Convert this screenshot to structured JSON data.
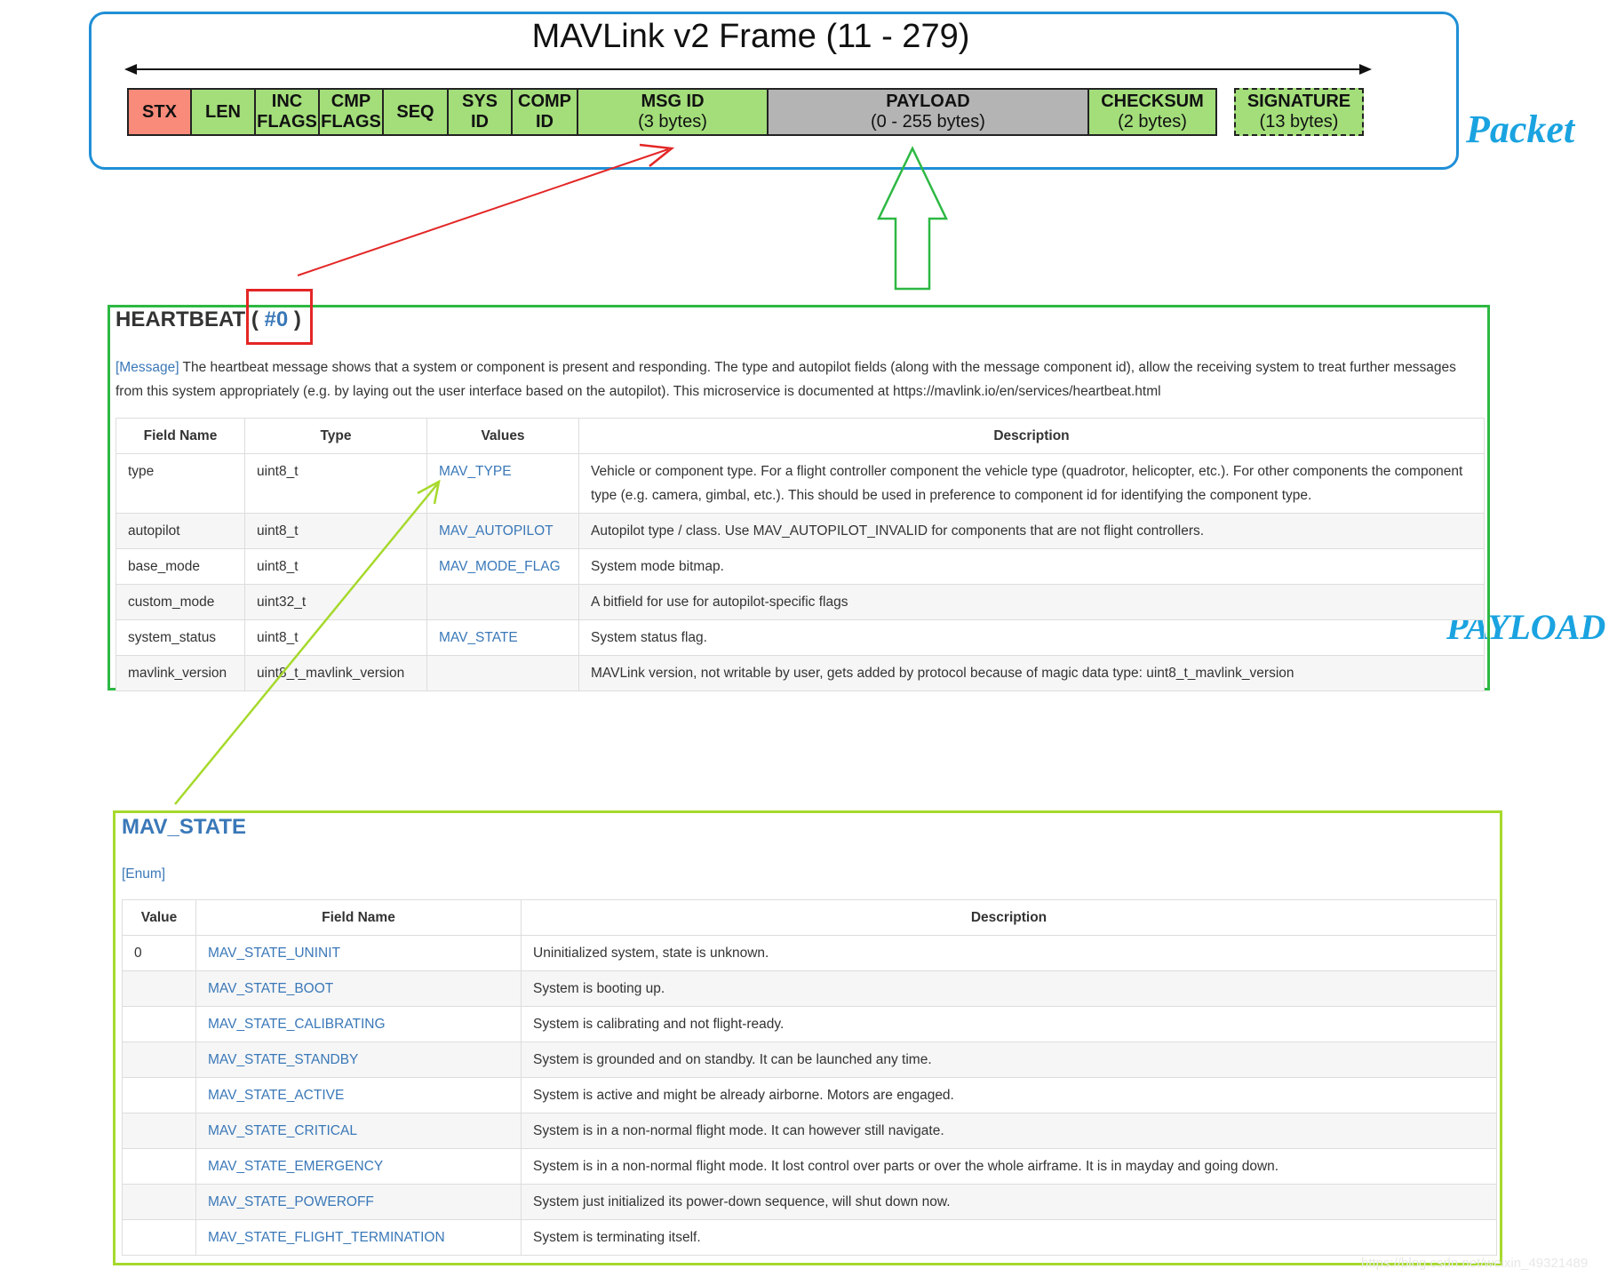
{
  "frame": {
    "title": "MAVLink v2 Frame (11 - 279)",
    "cells": [
      {
        "l1": "STX",
        "l2": "",
        "color": "#f98b7a"
      },
      {
        "l1": "LEN",
        "l2": "",
        "color": "#a3de7a"
      },
      {
        "l1": "INC",
        "l2": "FLAGS",
        "color": "#a3de7a"
      },
      {
        "l1": "CMP",
        "l2": "FLAGS",
        "color": "#a3de7a"
      },
      {
        "l1": "SEQ",
        "l2": "",
        "color": "#a3de7a"
      },
      {
        "l1": "SYS",
        "l2": "ID",
        "color": "#a3de7a"
      },
      {
        "l1": "COMP",
        "l2": "ID",
        "color": "#a3de7a"
      },
      {
        "l1": "MSG ID",
        "l2": "(3 bytes)",
        "color": "#a3de7a"
      },
      {
        "l1": "PAYLOAD",
        "l2": "(0 - 255 bytes)",
        "color": "#b4b4b4"
      },
      {
        "l1": "CHECKSUM",
        "l2": "(2 bytes)",
        "color": "#a3de7a"
      },
      {
        "l1": "SIGNATURE",
        "l2": "(13 bytes)",
        "color": "#a3de7a"
      }
    ]
  },
  "labels": {
    "packet": "Packet",
    "payload": "PAYLOAD"
  },
  "heartbeat": {
    "name": "HEARTBEAT",
    "open": " ( ",
    "msgid": "#0",
    "close": " )",
    "tag": "[Message]",
    "description": " The heartbeat message shows that a system or component is present and responding. The type and autopilot fields (along with the message component id), allow the receiving system to treat further messages from this system appropriately (e.g. by laying out the user interface based on the autopilot). This microservice is documented at https://mavlink.io/en/services/heartbeat.html",
    "headers": [
      "Field Name",
      "Type",
      "Values",
      "Description"
    ],
    "rows": [
      {
        "field": "type",
        "type": "uint8_t",
        "values": "MAV_TYPE",
        "desc": "Vehicle or component type. For a flight controller component the vehicle type (quadrotor, helicopter, etc.). For other components the component type (e.g. camera, gimbal, etc.). This should be used in preference to component id for identifying the component type."
      },
      {
        "field": "autopilot",
        "type": "uint8_t",
        "values": "MAV_AUTOPILOT",
        "desc": "Autopilot type / class. Use MAV_AUTOPILOT_INVALID for components that are not flight controllers."
      },
      {
        "field": "base_mode",
        "type": "uint8_t",
        "values": "MAV_MODE_FLAG",
        "desc": "System mode bitmap."
      },
      {
        "field": "custom_mode",
        "type": "uint32_t",
        "values": "",
        "desc": "A bitfield for use for autopilot-specific flags"
      },
      {
        "field": "system_status",
        "type": "uint8_t",
        "values": "MAV_STATE",
        "desc": "System status flag."
      },
      {
        "field": "mavlink_version",
        "type": "uint8_t_mavlink_version",
        "values": "",
        "desc": "MAVLink version, not writable by user, gets added by protocol because of magic data type: uint8_t_mavlink_version"
      }
    ]
  },
  "mav_state": {
    "title": "MAV_STATE",
    "tag": "[Enum]",
    "headers": [
      "Value",
      "Field Name",
      "Description"
    ],
    "rows": [
      {
        "value": "0",
        "field": "MAV_STATE_UNINIT",
        "desc": "Uninitialized system, state is unknown."
      },
      {
        "value": "",
        "field": "MAV_STATE_BOOT",
        "desc": "System is booting up."
      },
      {
        "value": "",
        "field": "MAV_STATE_CALIBRATING",
        "desc": "System is calibrating and not flight-ready."
      },
      {
        "value": "",
        "field": "MAV_STATE_STANDBY",
        "desc": "System is grounded and on standby. It can be launched any time."
      },
      {
        "value": "",
        "field": "MAV_STATE_ACTIVE",
        "desc": "System is active and might be already airborne. Motors are engaged."
      },
      {
        "value": "",
        "field": "MAV_STATE_CRITICAL",
        "desc": "System is in a non-normal flight mode. It can however still navigate."
      },
      {
        "value": "",
        "field": "MAV_STATE_EMERGENCY",
        "desc": "System is in a non-normal flight mode. It lost control over parts or over the whole airframe. It is in mayday and going down."
      },
      {
        "value": "",
        "field": "MAV_STATE_POWEROFF",
        "desc": "System just initialized its power-down sequence, will shut down now."
      },
      {
        "value": "",
        "field": "MAV_STATE_FLIGHT_TERMINATION",
        "desc": "System is terminating itself."
      }
    ]
  },
  "watermark": "https://blog.csdn.net/weixin_49321489"
}
